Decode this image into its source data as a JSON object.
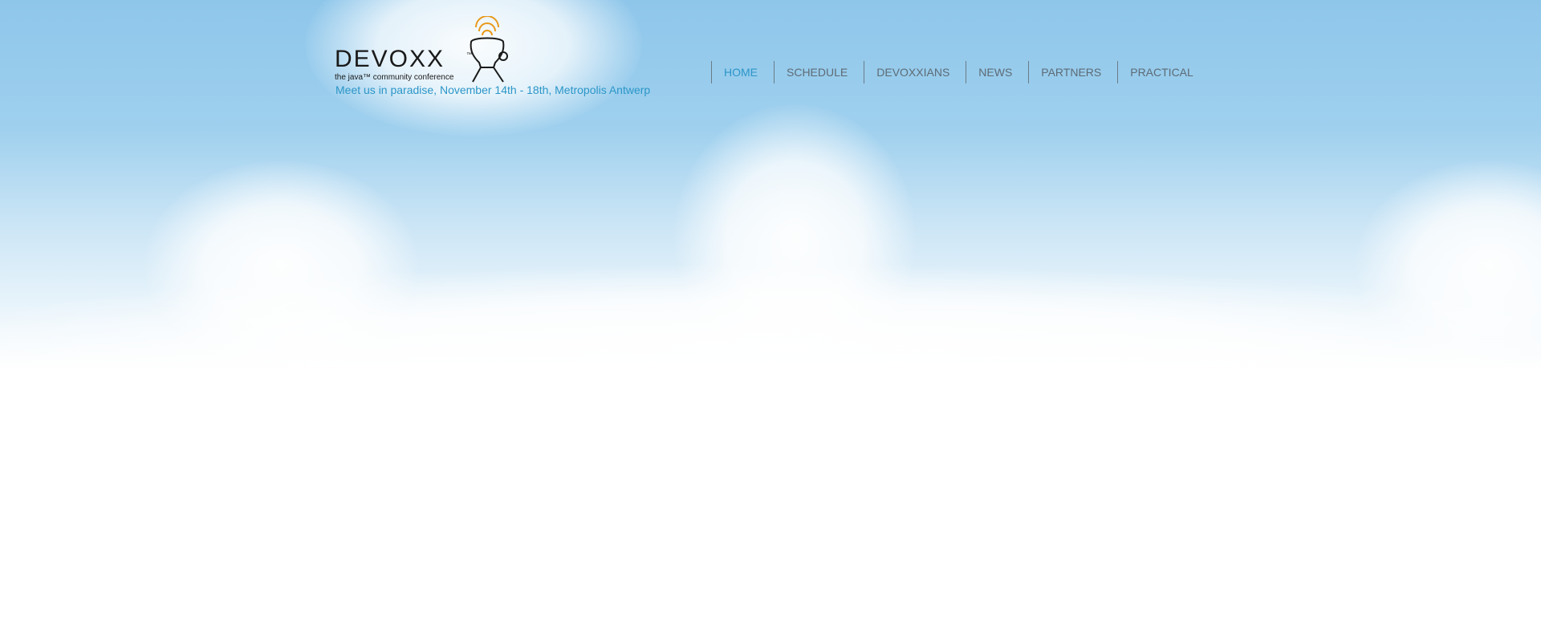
{
  "header": {
    "logo": {
      "wordmark": "DEVOXX",
      "trademark": "™",
      "subtitle": "the java™ community conference",
      "brand_colors": {
        "text": "#1a1a1a",
        "accent": "#e89a1c"
      }
    },
    "tagline": "Meet us in paradise, November 14th - 18th, Metropolis Antwerp"
  },
  "nav": {
    "items": [
      {
        "label": "HOME",
        "active": true
      },
      {
        "label": "SCHEDULE",
        "active": false
      },
      {
        "label": "DEVOXXIANS",
        "active": false
      },
      {
        "label": "NEWS",
        "active": false
      },
      {
        "label": "PARTNERS",
        "active": false
      },
      {
        "label": "PRACTICAL",
        "active": false
      }
    ],
    "active_color": "#2b96c8",
    "text_color": "#5d6b75"
  },
  "background": {
    "sky_color": "#8ec6ea",
    "page_color": "#ffffff"
  }
}
